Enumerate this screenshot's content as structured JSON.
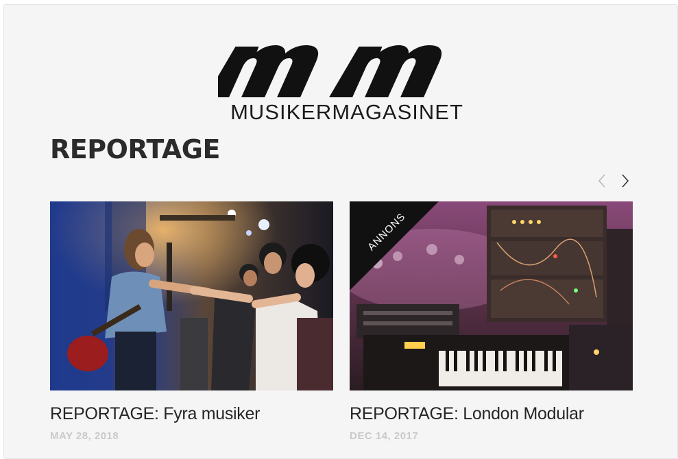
{
  "logo": {
    "text": "MUSIKERMAGASINET",
    "mark": "mm"
  },
  "section": {
    "title": "REPORTAGE"
  },
  "carousel": {
    "prev_icon": "chevron-left-icon",
    "next_icon": "chevron-right-icon"
  },
  "cards": [
    {
      "title": "REPORTAGE: Fyra musiker",
      "date": "MAY 28, 2018"
    },
    {
      "title": "REPORTAGE: London Modular",
      "date": "DEC 14, 2017",
      "badge": "ANNONS"
    }
  ],
  "colors": {
    "background": "#f5f5f5",
    "text": "#262626",
    "date": "#c9c9c9",
    "ribbon": "#111111"
  }
}
